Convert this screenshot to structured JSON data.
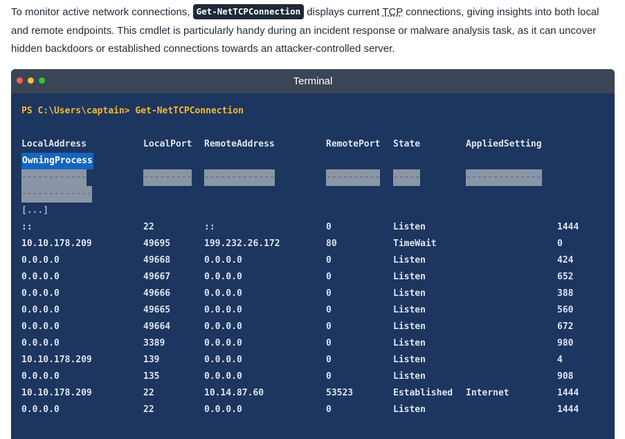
{
  "intro": {
    "before_code": "To monitor active network connections, ",
    "code": "Get-NetTCPConnection",
    "mid1": " displays current ",
    "tcp": "TCP",
    "mid2": " connections, giving insights into both local and remote endpoints. This cmdlet is particularly handy during an incident response or malware analysis task, as it can uncover hidden backdoors or established connections towards an attacker-controlled server."
  },
  "terminal": {
    "title": "Terminal",
    "prompt": "PS C:\\Users\\captain>",
    "command": "Get-NetTCPConnection",
    "headers": {
      "local_address": "LocalAddress",
      "local_port": "LocalPort",
      "remote_address": "RemoteAddress",
      "remote_port": "RemotePort",
      "state": "State",
      "applied_setting": "AppliedSetting",
      "owning_process": "OwningProcess"
    },
    "separators": {
      "local_address": "------------",
      "local_port": "---------",
      "remote_address": "-------------",
      "remote_port": "----------",
      "state": "-----",
      "applied_setting": "--------------",
      "owning_process": "-------------"
    },
    "ellipsis": "[...]",
    "rows": [
      [
        "::",
        "22",
        "::",
        "0",
        "Listen",
        "",
        "1444"
      ],
      [
        "10.10.178.209",
        "49695",
        "199.232.26.172",
        "80",
        "TimeWait",
        "",
        "0"
      ],
      [
        "0.0.0.0",
        "49668",
        "0.0.0.0",
        "0",
        "Listen",
        "",
        "424"
      ],
      [
        "0.0.0.0",
        "49667",
        "0.0.0.0",
        "0",
        "Listen",
        "",
        "652"
      ],
      [
        "0.0.0.0",
        "49666",
        "0.0.0.0",
        "0",
        "Listen",
        "",
        "388"
      ],
      [
        "0.0.0.0",
        "49665",
        "0.0.0.0",
        "0",
        "Listen",
        "",
        "560"
      ],
      [
        "0.0.0.0",
        "49664",
        "0.0.0.0",
        "0",
        "Listen",
        "",
        "672"
      ],
      [
        "0.0.0.0",
        "3389",
        "0.0.0.0",
        "0",
        "Listen",
        "",
        "980"
      ],
      [
        "10.10.178.209",
        "139",
        "0.0.0.0",
        "0",
        "Listen",
        "",
        "4"
      ],
      [
        "0.0.0.0",
        "135",
        "0.0.0.0",
        "0",
        "Listen",
        "",
        "908"
      ],
      [
        "10.10.178.209",
        "22",
        "10.14.87.60",
        "53523",
        "Established",
        "Internet",
        "1444"
      ],
      [
        "0.0.0.0",
        "22",
        "0.0.0.0",
        "0",
        "Listen",
        "",
        "1444"
      ]
    ]
  }
}
